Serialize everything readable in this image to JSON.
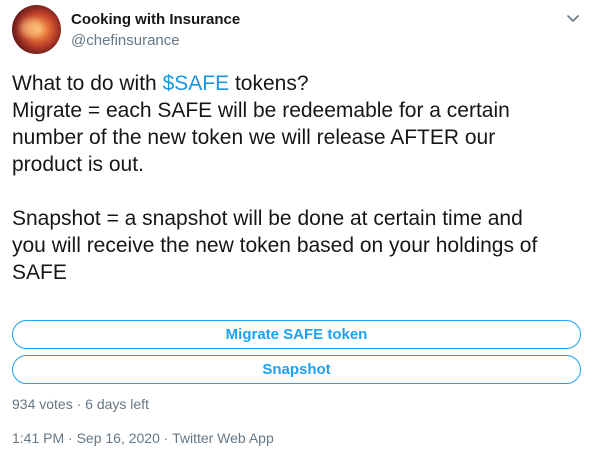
{
  "header": {
    "display_name": "Cooking with Insurance",
    "handle": "@chefinsurance"
  },
  "tweet": {
    "line1_prefix": "What to do with ",
    "line1_cashtag": "$SAFE",
    "line1_suffix": " tokens?",
    "line2": "Migrate = each SAFE will be redeemable for a certain",
    "line3": "number of the new token we will release AFTER our",
    "line4": "product is out.",
    "line5": "Snapshot = a snapshot will be done at certain time and",
    "line6": "you will receive the new token based on your holdings of",
    "line7": "SAFE"
  },
  "poll": {
    "options": [
      {
        "label": "Migrate SAFE token"
      },
      {
        "label": "Snapshot"
      }
    ],
    "meta": "934 votes · 6 days left"
  },
  "footer": {
    "timestamp": "1:41 PM · Sep 16, 2020 · Twitter Web App"
  },
  "colors": {
    "accent": "#1da1f2",
    "cashtag": "#1b95e0",
    "text": "#14171a",
    "muted": "#657786"
  },
  "icons": {
    "avatar": "avatar-photo",
    "menu": "chevron-down-icon"
  }
}
